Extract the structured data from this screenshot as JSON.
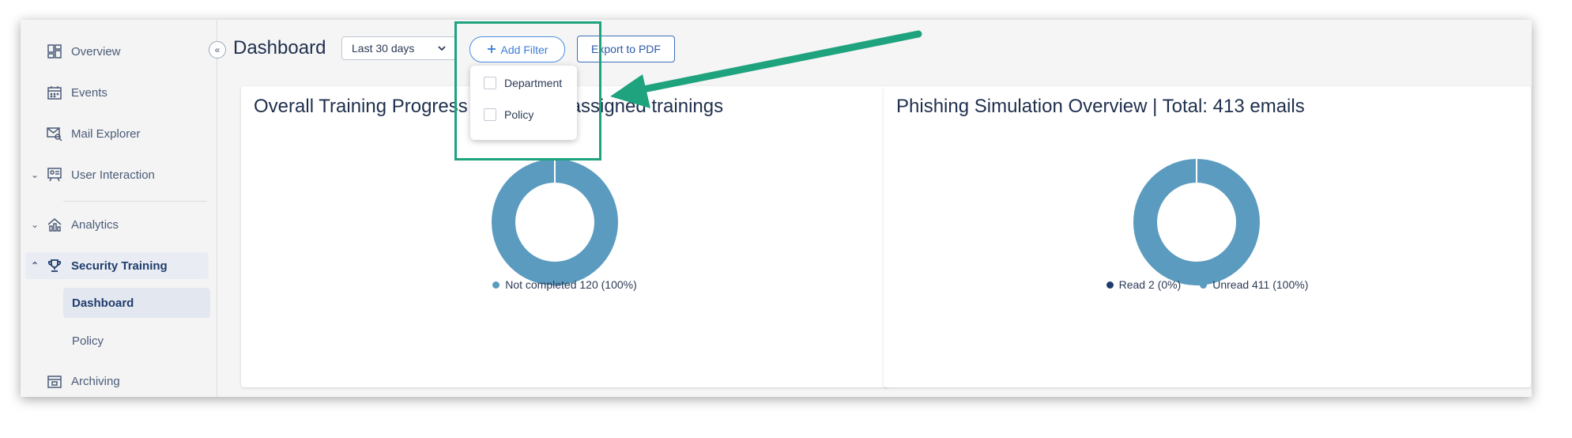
{
  "sidebar": {
    "items": [
      {
        "label": "Overview",
        "icon": "dashboard-grid-icon"
      },
      {
        "label": "Events",
        "icon": "calendar-icon"
      },
      {
        "label": "Mail Explorer",
        "icon": "mail-search-icon"
      },
      {
        "label": "User Interaction",
        "icon": "user-interaction-icon",
        "expand": "collapsed"
      },
      {
        "label": "Analytics",
        "icon": "analytics-icon",
        "expand": "collapsed"
      },
      {
        "label": "Security Training",
        "icon": "trophy-icon",
        "expand": "expanded"
      },
      {
        "label": "Archiving",
        "icon": "archive-icon"
      }
    ],
    "sub_items": [
      {
        "label": "Dashboard",
        "active": true
      },
      {
        "label": "Policy",
        "active": false
      }
    ]
  },
  "header": {
    "title": "Dashboard",
    "date_range": "Last 30 days",
    "add_filter_label": "Add Filter",
    "export_label": "Export to PDF"
  },
  "filter_dropdown": {
    "options": [
      "Department",
      "Policy"
    ]
  },
  "cards": {
    "training": {
      "title": "Overall Training Progress | Total: 120 assigned trainings",
      "legend": [
        {
          "label": "Not completed 120 (100%)",
          "color": "#5b9bbf"
        }
      ]
    },
    "phishing": {
      "title": "Phishing Simulation Overview | Total: 413 emails",
      "legend": [
        {
          "label": "Read 2 (0%)",
          "color": "#1f3d6e"
        },
        {
          "label": "Unread 411 (100%)",
          "color": "#5b9bbf"
        }
      ]
    }
  },
  "chart_data": [
    {
      "type": "pie",
      "categories": [
        "Not completed"
      ],
      "values": [
        120
      ]
    },
    {
      "type": "pie",
      "categories": [
        "Read",
        "Unread"
      ],
      "values": [
        2,
        411
      ]
    }
  ],
  "colors": {
    "accent": "#3b7dd8",
    "annotation": "#1fa37f",
    "donut": "#5b9bbf",
    "donut_dark": "#1f3d6e"
  }
}
